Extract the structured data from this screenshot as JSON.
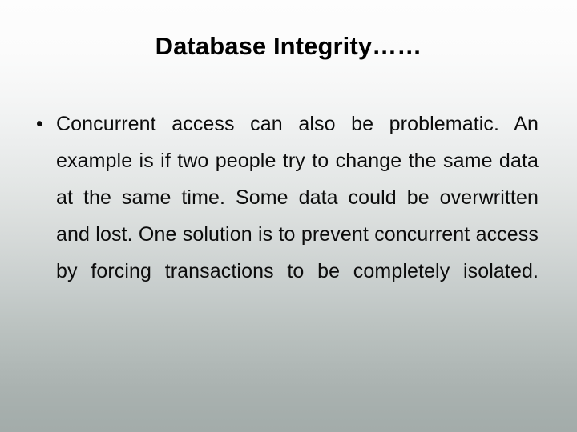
{
  "slide": {
    "title": "Database Integrity……",
    "background": {
      "top_color": "#fdfdfd",
      "mid_color": "#d6dad9",
      "bottom_color": "#a3acaa"
    },
    "text_color": "#0c0c0c",
    "bullets": [
      {
        "marker": "•",
        "text": "Concurrent access can also be problematic.  An example is if two people try to change the same data at the same time.  Some data could be overwritten and lost.   One solution is to prevent concurrent access by forcing transactions to be completely isolated."
      }
    ]
  }
}
